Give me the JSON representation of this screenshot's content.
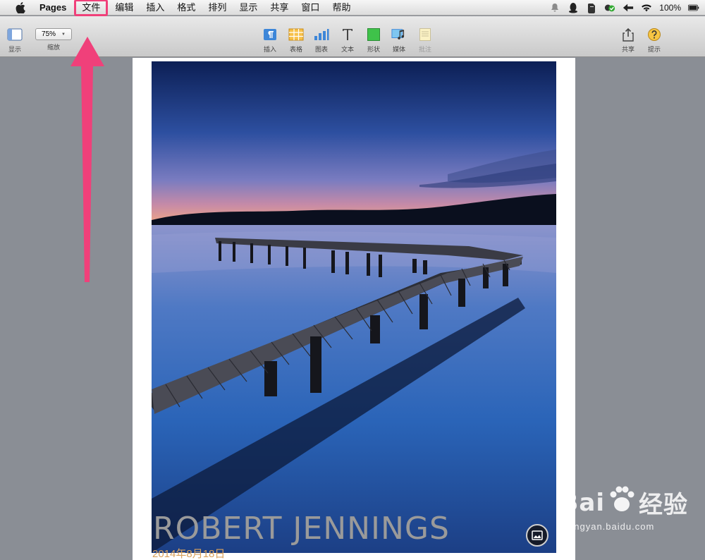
{
  "menubar": {
    "app_name": "Pages",
    "items": [
      "文件",
      "编辑",
      "插入",
      "格式",
      "排列",
      "显示",
      "共享",
      "窗口",
      "帮助"
    ],
    "highlighted_item": "文件",
    "battery": "100%"
  },
  "toolbar": {
    "view_label": "显示",
    "zoom_value": "75%",
    "zoom_label": "缩放",
    "insert_label": "插入",
    "table_label": "表格",
    "chart_label": "图表",
    "text_label": "文本",
    "shape_label": "形状",
    "media_label": "媒体",
    "comment_label": "批注",
    "share_label": "共享",
    "tips_label": "提示"
  },
  "document": {
    "title": "ROBERT JENNINGS",
    "date": "2014年8月18日"
  },
  "watermark": {
    "brand": "Bai",
    "brand_cn": "经验",
    "url": "jingyan.baidu.com"
  },
  "colors": {
    "highlight": "#f0407a",
    "date_accent": "#d9a05a",
    "title_gray": "#9a9a9a"
  }
}
